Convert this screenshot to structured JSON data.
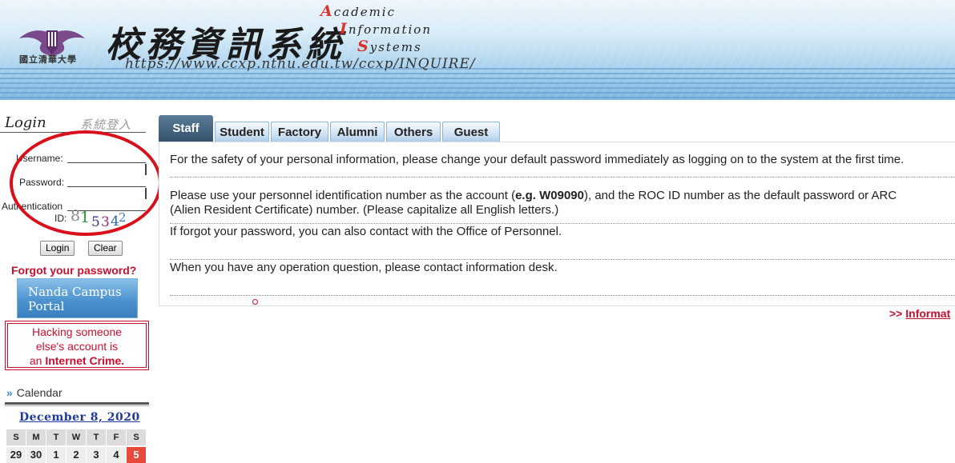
{
  "header": {
    "logo_caption": "國立清華大學",
    "title_zh": "校務資訊系統",
    "title_en": [
      {
        "cap": "A",
        "rest": "cademic"
      },
      {
        "cap": "I",
        "rest": "nformation"
      },
      {
        "cap": "S",
        "rest": "ystems"
      }
    ],
    "url": "https://www.ccxp.nthu.edu.tw/ccxp/INQUIRE/"
  },
  "sidebar": {
    "login_title": "Login",
    "login_title_zh": "系統登入",
    "username_label": "Username:",
    "password_label": "Password:",
    "auth_label_1": "Authentication",
    "auth_label_2": "ID:",
    "captcha_chars": [
      "8",
      "1",
      "5",
      "3",
      "4",
      "2"
    ],
    "login_button": "Login",
    "clear_button": "Clear",
    "forgot_password": "Forgot your password?",
    "nanda_line1": "Nanda Campus",
    "nanda_line2": "Portal",
    "hack_line1": "Hacking someone",
    "hack_line2": "else's account is",
    "hack_line3a": "an ",
    "hack_line3b": "Internet Crime."
  },
  "calendar": {
    "heading_arrow": "»",
    "heading": "Calendar",
    "month": "December 8, 2020",
    "dow": [
      "S",
      "M",
      "T",
      "W",
      "T",
      "F",
      "S"
    ],
    "days": [
      "29",
      "30",
      "1",
      "2",
      "3",
      "4",
      "5"
    ],
    "today_color": "#e74a3b"
  },
  "tabs": {
    "active": "Staff",
    "items": [
      "Student",
      "Factory",
      "Alumni",
      "Others",
      "Guest"
    ]
  },
  "main": {
    "msg1": "For the safety of your personal information, please change your default password immediately as logging on to the system at the first time.",
    "msg2a": "Please use your personnel identification number as the account (",
    "msg2b": "e.g. W09090",
    "msg2c": "), and the ROC ID number as the default password or ARC",
    "msg2d": "(Alien Resident Certificate) number. (Please capitalize all English letters.)",
    "msg3": "If forgot your password, you can also contact with the Office of Personnel.",
    "msg4": "When you have any operation question, please contact information desk.",
    "info_prefix": ">> ",
    "info_link": "Informat"
  },
  "colors": {
    "accent_red": "#c8102e",
    "tab_active": "#34516b",
    "annotation": "#d8101c"
  }
}
